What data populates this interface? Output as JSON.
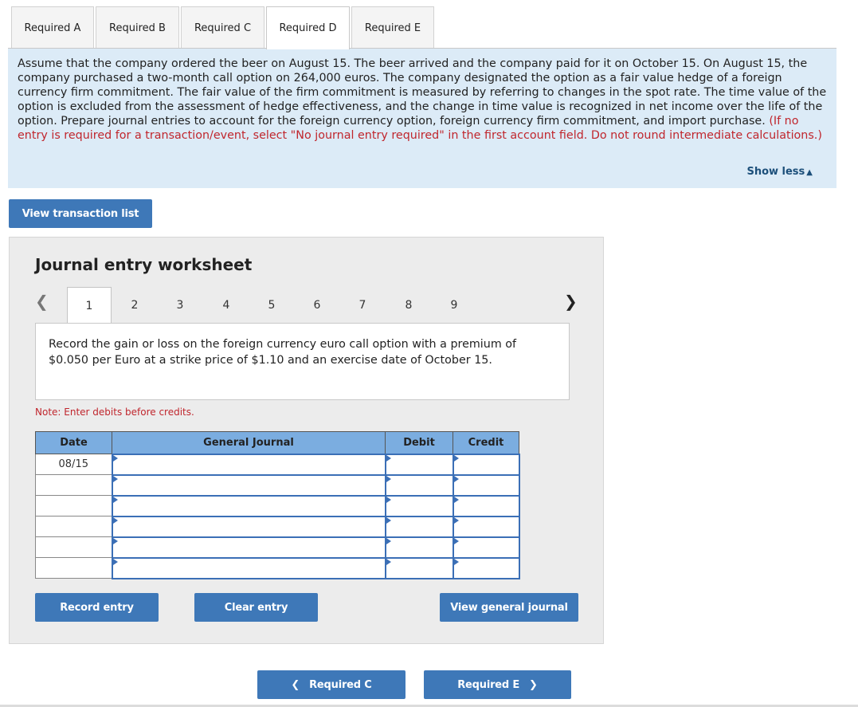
{
  "tabs": [
    {
      "label": "Required A",
      "active": false
    },
    {
      "label": "Required B",
      "active": false
    },
    {
      "label": "Required C",
      "active": false
    },
    {
      "label": "Required D",
      "active": true
    },
    {
      "label": "Required E",
      "active": false
    }
  ],
  "problem": {
    "text": "Assume that the company ordered the beer on August 15. The beer arrived and the company paid for it on October 15. On August 15, the company purchased a two-month call option on 264,000 euros. The company designated the option as a fair value hedge of a foreign currency firm commitment. The fair value of the firm commitment is measured by referring to changes in the spot rate. The time value of the option is excluded from the assessment of hedge effectiveness, and the change in time value is recognized in net income over the life of the option. Prepare journal entries to account for the foreign currency option, foreign currency firm commitment, and import purchase.",
    "instruction": "(If no entry is required for a transaction/event, select \"No journal entry required\" in the first account field. Do not round intermediate calculations.)",
    "show_less": "Show less"
  },
  "buttons": {
    "view_transaction_list": "View transaction list",
    "record_entry": "Record entry",
    "clear_entry": "Clear entry",
    "view_general_journal": "View general journal",
    "prev_required": "Required C",
    "next_required": "Required E"
  },
  "worksheet": {
    "title": "Journal entry worksheet",
    "pages": [
      "1",
      "2",
      "3",
      "4",
      "5",
      "6",
      "7",
      "8",
      "9"
    ],
    "active_page": "1",
    "instruction": "Record the gain or loss on the foreign currency euro call option with a premium of $0.050 per Euro at a strike price of $1.10 and an exercise date of October 15.",
    "note": "Note: Enter debits before credits.",
    "columns": {
      "date": "Date",
      "general_journal": "General Journal",
      "debit": "Debit",
      "credit": "Credit"
    },
    "rows": [
      {
        "date": "08/15",
        "account": "",
        "debit": "",
        "credit": ""
      },
      {
        "date": "",
        "account": "",
        "debit": "",
        "credit": ""
      },
      {
        "date": "",
        "account": "",
        "debit": "",
        "credit": ""
      },
      {
        "date": "",
        "account": "",
        "debit": "",
        "credit": ""
      },
      {
        "date": "",
        "account": "",
        "debit": "",
        "credit": ""
      },
      {
        "date": "",
        "account": "",
        "debit": "",
        "credit": ""
      }
    ]
  },
  "colors": {
    "accent": "#3e78b8",
    "problem_bg": "#dcebf7",
    "header_blue": "#7bade0",
    "note_red": "#c0262d"
  }
}
